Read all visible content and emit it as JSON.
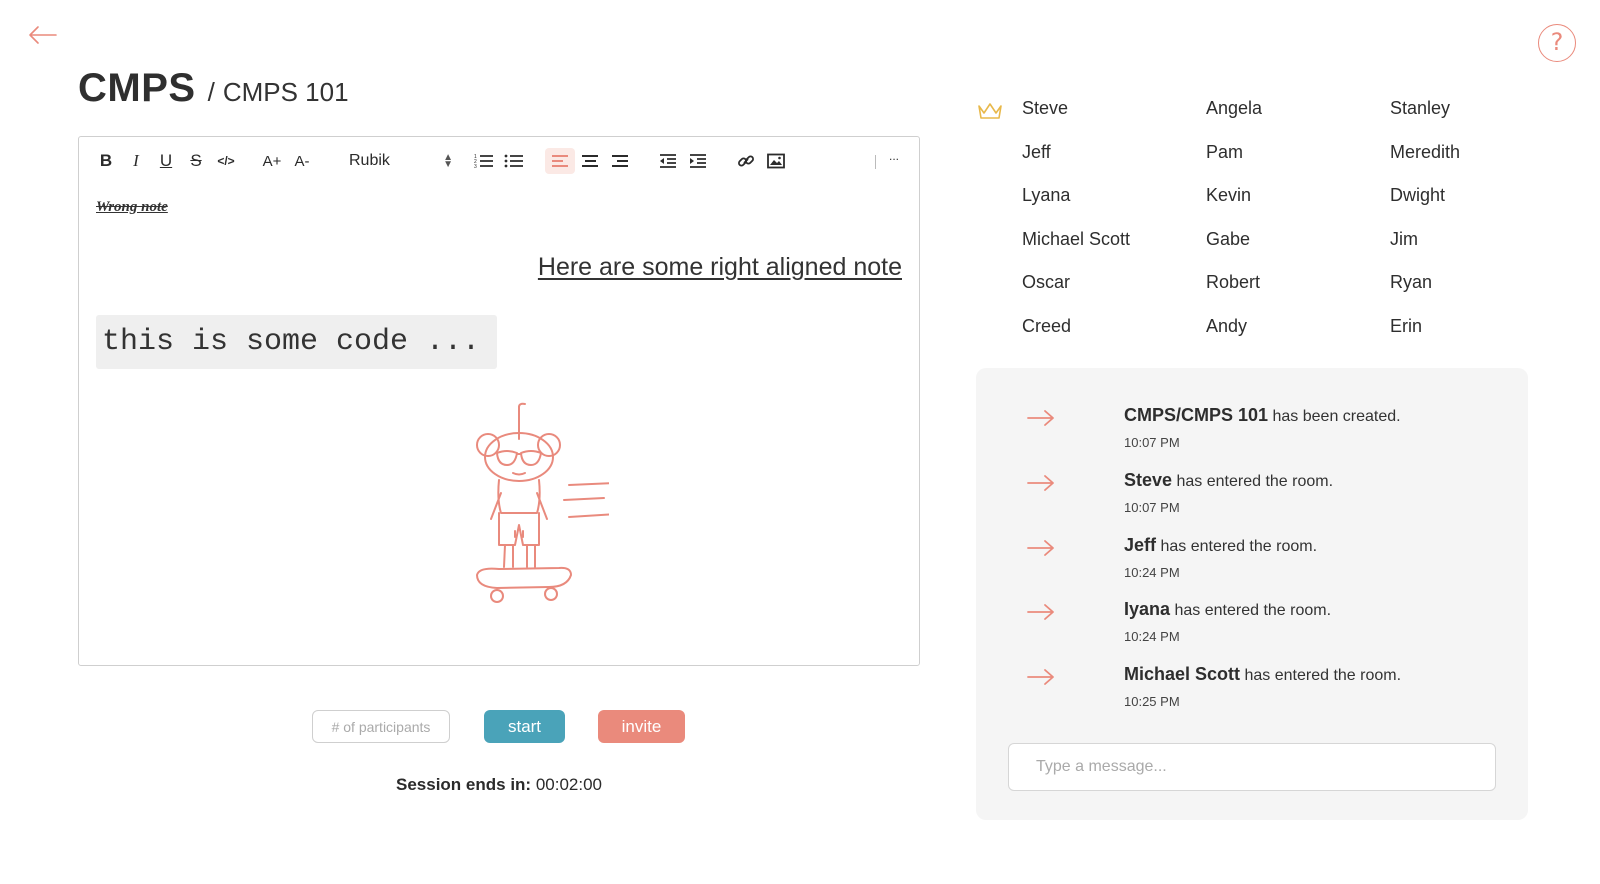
{
  "header": {
    "back_icon": "arrow-left-icon",
    "help_icon": "question-mark-icon",
    "help_symbol": "?",
    "title_main": "CMPS",
    "title_separator": "/",
    "title_sub": "CMPS 101"
  },
  "toolbar": {
    "bold": "B",
    "italic": "I",
    "underline": "U",
    "strike": "S",
    "code": "</>",
    "font_increase": "A+",
    "font_decrease": "A-",
    "font": "Rubik",
    "more": "..."
  },
  "editor": {
    "wrong_note": "Wrong note",
    "right_note": "Here are some right aligned note",
    "code": "this is some code ..."
  },
  "controls": {
    "participants_placeholder": "# of participants",
    "start_label": "start",
    "invite_label": "invite",
    "session_label": "Session ends in:",
    "session_time": "00:02:00"
  },
  "members": [
    "Steve",
    "Angela",
    "Stanley",
    "Jeff",
    "Pam",
    "Meredith",
    "Lyana",
    "Kevin",
    "Dwight",
    "Michael Scott",
    "Gabe",
    "Jim",
    "Oscar",
    "Robert",
    "Ryan",
    "Creed",
    "Andy",
    "Erin"
  ],
  "chat": {
    "events": [
      {
        "who": "CMPS/CMPS 101",
        "what": "has been created.",
        "time": "10:07 PM"
      },
      {
        "who": "Steve",
        "what": "has entered the room.",
        "time": "10:07 PM"
      },
      {
        "who": "Jeff",
        "what": "has entered the room.",
        "time": "10:24 PM"
      },
      {
        "who": "Iyana",
        "what": "has entered the room.",
        "time": "10:24 PM"
      },
      {
        "who": "Michael Scott",
        "what": "has entered the room.",
        "time": "10:25 PM"
      }
    ],
    "input_placeholder": "Type a message..."
  },
  "colors": {
    "accent": "#ea8a7c",
    "start": "#4aa3b9",
    "crown": "#e8b84a",
    "chat_bg": "#f5f5f5"
  }
}
